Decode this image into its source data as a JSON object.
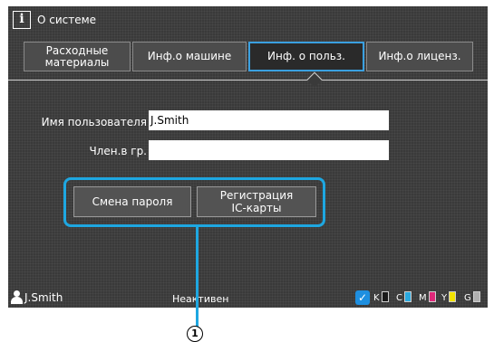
{
  "header": {
    "icon": "info-icon",
    "icon_glyph": "i",
    "title": "О системе"
  },
  "tabs": [
    {
      "label": "Расходные\nматериалы",
      "active": false
    },
    {
      "label": "Инф.о машине",
      "active": false
    },
    {
      "label": "Инф. о польз.",
      "active": true
    },
    {
      "label": "Инф.о лиценз.",
      "active": false
    }
  ],
  "form": {
    "username_label": "Имя пользователя",
    "username_value": "J.Smith",
    "group_label": "Член.в гр.",
    "group_value": ""
  },
  "buttons": {
    "change_password": "Смена пароля",
    "register_card": "Регистрация\nIC-карты"
  },
  "status_bar": {
    "user": "J.Smith",
    "state": "Неактивен",
    "inks": [
      {
        "label": "K",
        "color": "#ffffff"
      },
      {
        "label": "C",
        "color": "#2aa9e0"
      },
      {
        "label": "M",
        "color": "#e0287a"
      },
      {
        "label": "Y",
        "color": "#f2e200"
      },
      {
        "label": "G",
        "color": "#b0b0b0"
      }
    ]
  },
  "callout": {
    "number": "1"
  },
  "colors": {
    "accent": "#1ea7e1",
    "background": "#3a3a3a"
  }
}
